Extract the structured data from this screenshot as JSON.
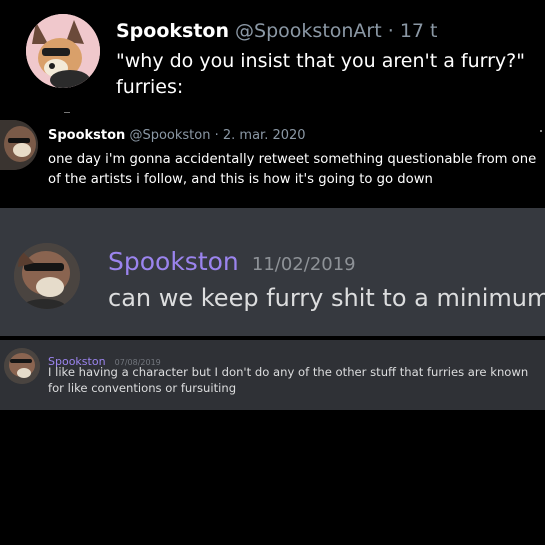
{
  "tweet_main": {
    "name": "Spookston",
    "handle": "@SpookstonArt",
    "time": " · 17 t",
    "text_line1": "\"why do you insist that you aren't a furry?\"",
    "text_line2": "furries:"
  },
  "tweet_quoted": {
    "name": "Spookston",
    "handle": "@Spookston",
    "time": " · 2. mar. 2020",
    "text": "one day i'm gonna accidentally retweet something questionable from one of the artists i follow, and this is how it's going to go down"
  },
  "discord_message_1": {
    "name": "Spookston",
    "time": "11/02/2019",
    "text": "can we keep furry shit to a minimum"
  },
  "discord_message_2": {
    "name": "Spookston",
    "time": "07/08/2019",
    "text": "I like having a character but I don't do any of the other stuff that furries are known for like conventions or fursuiting"
  },
  "colors": {
    "background": "#000000",
    "discord_bg": "#36393f",
    "discord_bg_small": "#2f3136",
    "discord_name": "#9b84ee",
    "twitter_handle": "#8b98a5"
  },
  "icons": [
    "avatar-furry-pink",
    "avatar-furry-dark"
  ]
}
